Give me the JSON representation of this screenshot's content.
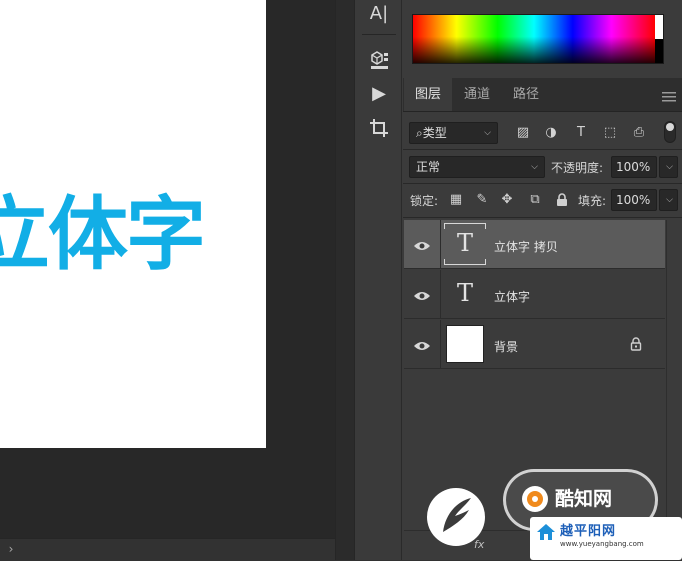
{
  "canvas": {
    "document_text": "立体字",
    "text_color": "#12aee6",
    "scroll_left_glyph": "›"
  },
  "tools": [
    {
      "icon": "type-tool-icon",
      "glyph": "A|"
    },
    {
      "icon": "3d-object-icon",
      "glyph": "▣"
    },
    {
      "icon": "play-icon",
      "glyph": "▶"
    },
    {
      "icon": "crop-tool-icon",
      "glyph": "⌗"
    }
  ],
  "tabs": [
    {
      "label": "图层",
      "active": true
    },
    {
      "label": "通道",
      "active": false
    },
    {
      "label": "路径",
      "active": false
    }
  ],
  "panel_menu_icon": "hamburger-menu-icon",
  "filter": {
    "search_glyph": "⌕",
    "kind_label": "类型",
    "icons": [
      "image-filter-icon",
      "adjustment-filter-icon",
      "type-filter-icon",
      "shape-filter-icon",
      "smart-object-filter-icon"
    ],
    "glyphs": [
      "▨",
      "◑",
      "T",
      "⬚",
      "⎙"
    ]
  },
  "blend": {
    "mode": "正常",
    "opacity_label": "不透明度:",
    "opacity_value": "100%"
  },
  "lock": {
    "label": "锁定:",
    "icons": [
      "lock-transparent-pixels-icon",
      "lock-image-pixels-icon",
      "lock-position-icon",
      "lock-artboard-icon",
      "lock-all-icon"
    ],
    "glyphs": [
      "▦",
      "✎",
      "✥",
      "⧉",
      "🔒"
    ],
    "fill_label": "填充:",
    "fill_value": "100%"
  },
  "layers": [
    {
      "name": "立体字 拷贝",
      "type": "text",
      "thumb_glyph": "T",
      "selected": true,
      "locked": false
    },
    {
      "name": "立体字",
      "type": "text",
      "thumb_glyph": "T",
      "selected": false,
      "locked": false
    },
    {
      "name": "背景",
      "type": "image",
      "thumb_glyph": "",
      "selected": false,
      "locked": true
    }
  ],
  "bottom": {
    "fx_label": "fx"
  },
  "watermarks": {
    "knowledge_text": "酷知网",
    "site_title": "越平阳网",
    "site_url": "www.yueyangbang.com"
  }
}
